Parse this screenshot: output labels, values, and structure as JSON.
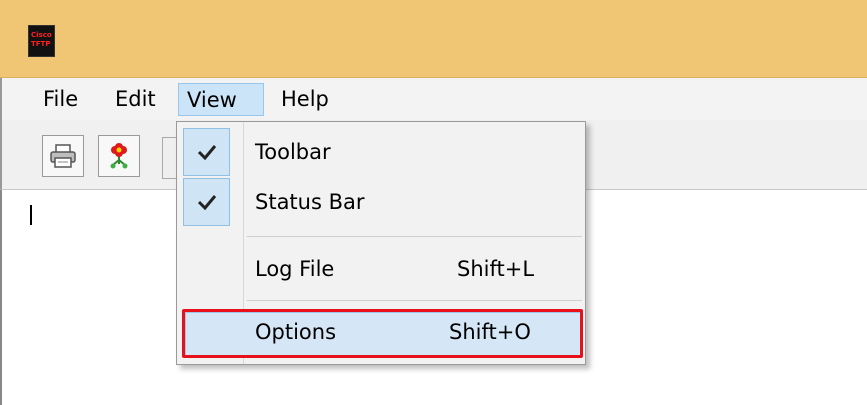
{
  "window": {
    "icon_line1": "Cisco",
    "icon_line2": "TFTP"
  },
  "menubar": {
    "items": [
      {
        "label": "File"
      },
      {
        "label": "Edit"
      },
      {
        "label": "View"
      },
      {
        "label": "Help"
      }
    ],
    "active": "View"
  },
  "toolbar": {
    "buttons": [
      {
        "icon": "printer-icon"
      },
      {
        "icon": "flower-icon"
      }
    ]
  },
  "view_menu": {
    "items": [
      {
        "label": "Toolbar",
        "checked": true,
        "shortcut": ""
      },
      {
        "label": "Status Bar",
        "checked": true,
        "shortcut": ""
      },
      {
        "label": "Log File",
        "checked": false,
        "shortcut": "Shift+L"
      },
      {
        "label": "Options",
        "checked": false,
        "shortcut": "Shift+O",
        "highlighted": true
      }
    ]
  },
  "colors": {
    "titlebar": "#f0c674",
    "highlight": "#d5e7f6",
    "callout": "#e8101a"
  }
}
